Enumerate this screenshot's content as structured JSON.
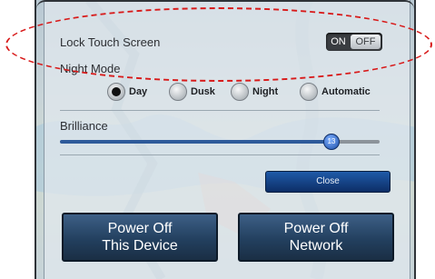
{
  "settings": {
    "lock_touch_screen_label": "Lock Touch Screen",
    "lock_toggle": {
      "on_label": "ON",
      "off_label": "OFF",
      "state": "off"
    },
    "night_mode_label": "Night Mode",
    "night_mode_options": [
      {
        "label": "Day",
        "selected": true
      },
      {
        "label": "Dusk",
        "selected": false
      },
      {
        "label": "Night",
        "selected": false
      },
      {
        "label": "Automatic",
        "selected": false
      }
    ],
    "brilliance_label": "Brilliance",
    "brilliance_value": "13",
    "brilliance_fraction": 0.84
  },
  "buttons": {
    "close_label": "Close",
    "power_off_device_line1": "Power Off",
    "power_off_device_line2": "This Device",
    "power_off_network_line1": "Power Off",
    "power_off_network_line2": "Network"
  },
  "colors": {
    "annotation": "#d81a1a",
    "accent_blue": "#1d4fa8"
  }
}
